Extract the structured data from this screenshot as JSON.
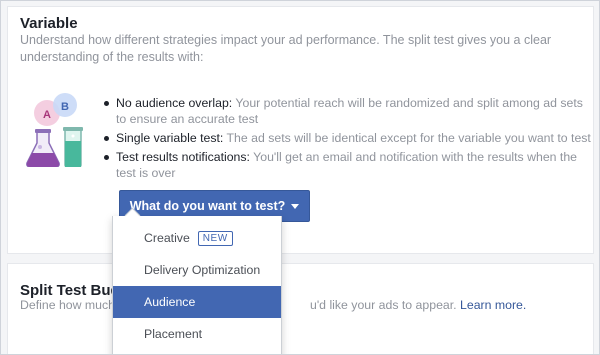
{
  "variable": {
    "title": "Variable",
    "description": "Understand how different strategies impact your ad performance. The split test gives you a clear understanding of the results with:",
    "bullets": [
      {
        "strong": "No audience overlap:",
        "text": " Your potential reach will be randomized and split among ad sets to ensure an accurate test"
      },
      {
        "strong": "Single variable test:",
        "text": " The ad sets will be identical except for the variable you want to test"
      },
      {
        "strong": "Test results notifications:",
        "text": " You'll get an email and notification with the results when the test is over"
      }
    ],
    "illustration": {
      "badge_a": "A",
      "badge_b": "B"
    }
  },
  "test_button": {
    "label": "What do you want to test?"
  },
  "dropdown": {
    "items": [
      {
        "label": "Creative",
        "badge": "NEW",
        "selected": false
      },
      {
        "label": "Delivery Optimization",
        "selected": false
      },
      {
        "label": "Audience",
        "selected": true
      },
      {
        "label": "Placement",
        "selected": false
      }
    ]
  },
  "budget": {
    "title": "Split Test Budg",
    "description_start": "Define how much",
    "description_end": "u'd like your ads to appear.",
    "learn_more": "Learn more."
  },
  "colors": {
    "accent": "#4267b2",
    "text_dark": "#1d2129",
    "text_muted": "#90949c",
    "link": "#365899"
  }
}
